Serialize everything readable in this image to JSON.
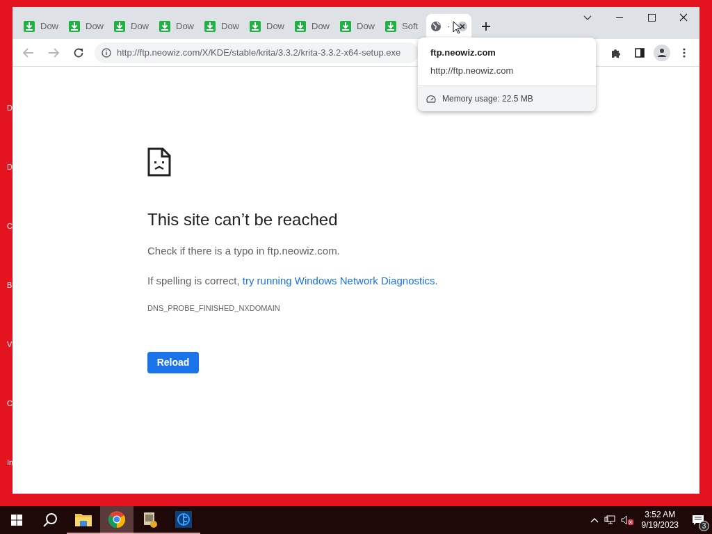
{
  "desktop_icons": [
    {
      "label": "D"
    },
    {
      "label": "D"
    },
    {
      "label": "C"
    },
    {
      "label": "B"
    },
    {
      "label": "V"
    },
    {
      "label": "C"
    },
    {
      "label": "In"
    }
  ],
  "tabs": [
    {
      "title": "Dow",
      "kind": "download",
      "selected": false
    },
    {
      "title": "Dow",
      "kind": "download",
      "selected": false
    },
    {
      "title": "Dow",
      "kind": "download",
      "selected": false
    },
    {
      "title": "Dow",
      "kind": "download",
      "selected": false
    },
    {
      "title": "Dow",
      "kind": "download",
      "selected": false
    },
    {
      "title": "Dow",
      "kind": "download",
      "selected": false
    },
    {
      "title": "Dow",
      "kind": "download",
      "selected": false
    },
    {
      "title": "Dow",
      "kind": "download",
      "selected": false
    },
    {
      "title": "Soft",
      "kind": "download",
      "selected": false
    },
    {
      "title": "·",
      "kind": "globe",
      "selected": true
    }
  ],
  "address": "http://ftp.neowiz.com/X/KDE/stable/krita/3.3.2/krita-3.3.2-x64-setup.exe",
  "tab_hover_card": {
    "title": "ftp.neowiz.com",
    "url": "http://ftp.neowiz.com",
    "memory": "Memory usage: 22.5 MB"
  },
  "error": {
    "title": "This site can’t be reached",
    "line1": "Check if there is a typo in ftp.neowiz.com.",
    "line2_prefix": "If spelling is correct, ",
    "line2_link": "try running Windows Network Diagnostics",
    "line2_suffix": ".",
    "code": "DNS_PROBE_FINISHED_NXDOMAIN",
    "button": "Reload"
  },
  "taskbar": {
    "apps": [
      {
        "kind": "folder",
        "selected": false
      },
      {
        "kind": "chrome",
        "selected": true
      },
      {
        "kind": "installer",
        "selected": false
      },
      {
        "kind": "blue",
        "selected": false
      }
    ],
    "time": "3:52 AM",
    "date": "9/19/2023",
    "notifications": "3"
  }
}
